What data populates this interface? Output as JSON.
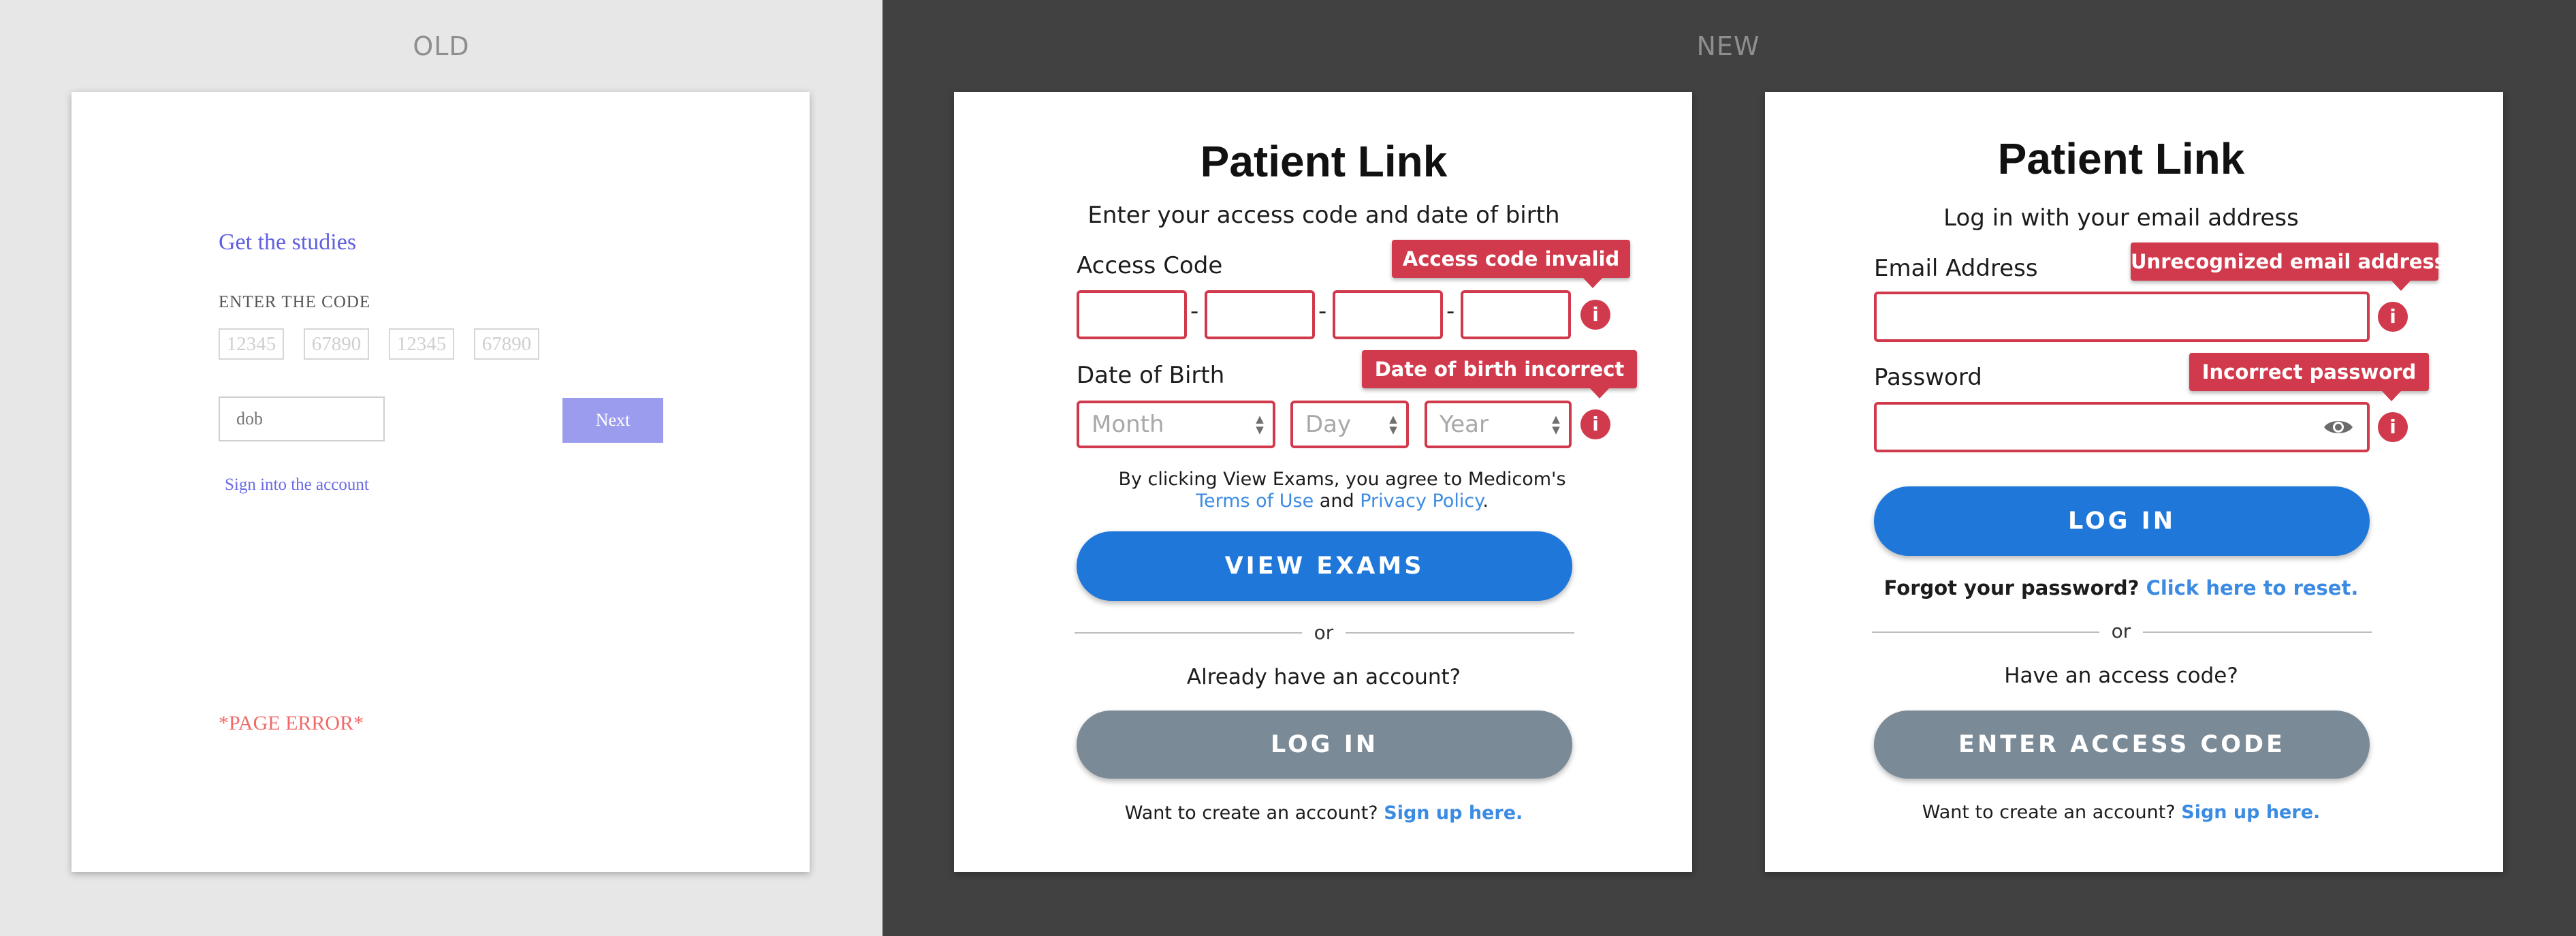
{
  "labels": {
    "old": "OLD",
    "new": "NEW"
  },
  "old": {
    "heading": "Get the studies",
    "code_label": "ENTER THE CODE",
    "code_placeholders": [
      "12345",
      "67890",
      "12345",
      "67890"
    ],
    "dob_placeholder": "dob",
    "next_label": "Next",
    "signin_link": "Sign into the account",
    "error_text": "*PAGE ERROR*"
  },
  "access_screen": {
    "title": "Patient Link",
    "subtitle": "Enter your access code and date of birth",
    "access_code_label": "Access Code",
    "access_code_error": "Access code invalid",
    "separator": "-",
    "dob_label": "Date of Birth",
    "dob_error": "Date of birth incorrect",
    "month_placeholder": "Month",
    "day_placeholder": "Day",
    "year_placeholder": "Year",
    "terms_prefix": "By clicking View Exams, you agree to Medicom's",
    "terms_link": "Terms of Use",
    "terms_and": "and",
    "privacy_link": "Privacy Policy",
    "terms_period": ".",
    "view_exams_label": "VIEW EXAMS",
    "or_text": "or",
    "have_account_text": "Already have an account?",
    "login_label": "LOG IN",
    "create_prompt": "Want to create an account?",
    "signup_link": "Sign up here."
  },
  "login_screen": {
    "title": "Patient Link",
    "subtitle": "Log in with your email address",
    "email_label": "Email Address",
    "email_error": "Unrecognized email address",
    "password_label": "Password",
    "password_error": "Incorrect password",
    "login_label": "LOG IN",
    "forgot_prompt": "Forgot your password?",
    "reset_link": "Click here to reset.",
    "or_text": "or",
    "have_code_text": "Have an access code?",
    "enter_code_label": "ENTER ACCESS CODE",
    "create_prompt": "Want to create an account?",
    "signup_link": "Sign up here."
  },
  "colors": {
    "error": "#d13a4c",
    "primary": "#1e77d9",
    "secondary": "#7a8a96",
    "link": "#3c8be2",
    "old_accent": "#6060e0"
  },
  "icons": {
    "info": "info-icon",
    "eye": "eye-icon",
    "select_arrows": "chevron-updown-icon"
  }
}
